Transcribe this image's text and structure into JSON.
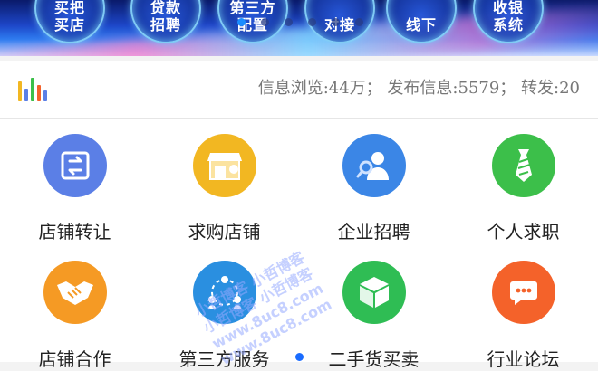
{
  "banner": {
    "bubbles": [
      {
        "line1": "买把",
        "line2": "买店"
      },
      {
        "line1": "贷款",
        "line2": "招聘"
      },
      {
        "line1": "第三方",
        "line2": "配置"
      },
      {
        "line1": "",
        "line2": "对接"
      },
      {
        "line1": "",
        "line2": "线下"
      },
      {
        "line1": "收银",
        "line2": "系统"
      }
    ],
    "active_slide": 1,
    "slide_count": 6
  },
  "stats": {
    "views_label": "信息浏览:44万；",
    "posts_label": "发布信息:5579；",
    "shares_label": "转发:20"
  },
  "menu": {
    "items": [
      {
        "label": "店铺转让",
        "icon": "transfer-icon",
        "color": "#5b7fe6"
      },
      {
        "label": "求购店铺",
        "icon": "shop-icon",
        "color": "#f2b722"
      },
      {
        "label": "企业招聘",
        "icon": "recruit-icon",
        "color": "#3b86e6"
      },
      {
        "label": "个人求职",
        "icon": "tie-icon",
        "color": "#3cbf4a"
      },
      {
        "label": "店铺合作",
        "icon": "handshake-icon",
        "color": "#f59a24"
      },
      {
        "label": "第三方服务",
        "icon": "people-network-icon",
        "color": "#2a8fe0"
      },
      {
        "label": "二手货买卖",
        "icon": "box-icon",
        "color": "#2fbd54"
      },
      {
        "label": "行业论坛",
        "icon": "chat-icon",
        "color": "#f4622a"
      }
    ]
  },
  "watermark": {
    "line1": "小哲博客 小哲博客",
    "line2": "小哲博客 小哲博客",
    "line3": "www.8uc8.com",
    "line4": "www.8uc8.com"
  },
  "colors": {
    "accent": "#1a8cff",
    "chart_bars": [
      "#f2b722",
      "#5b7fe6",
      "#3cbf4a",
      "#f4622a",
      "#5b7fe6"
    ]
  }
}
